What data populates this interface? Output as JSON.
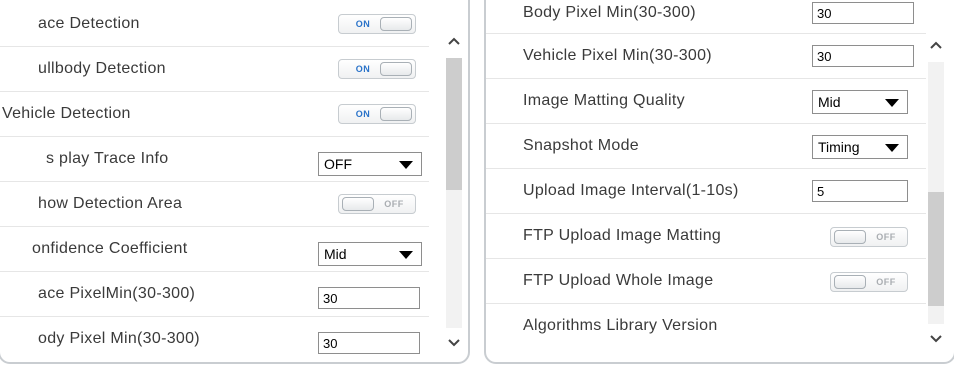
{
  "left_panel": {
    "rows": [
      {
        "label": "ace Detection",
        "control": "toggle",
        "state": "ON"
      },
      {
        "label": "ullbody Detection",
        "control": "toggle",
        "state": "ON"
      },
      {
        "label": "Vehicle Detection",
        "control": "toggle",
        "state": "ON"
      },
      {
        "label": "s play Trace Info",
        "control": "select",
        "value": "OFF"
      },
      {
        "label": "how Detection Area",
        "control": "toggle",
        "state": "OFF"
      },
      {
        "label": "onfidence Coefficient",
        "control": "select",
        "value": "Mid"
      },
      {
        "label": "ace PixelMin(30-300)",
        "control": "input",
        "value": "30"
      },
      {
        "label": "ody Pixel Min(30-300)",
        "control": "input",
        "value": "30"
      }
    ],
    "scroll_position": 0.2
  },
  "right_panel": {
    "rows": [
      {
        "label": "Body Pixel Min(30-300)",
        "control": "input",
        "value": "30"
      },
      {
        "label": "Vehicle Pixel Min(30-300)",
        "control": "input",
        "value": "30"
      },
      {
        "label": "Image Matting Quality",
        "control": "select",
        "value": "Mid"
      },
      {
        "label": "Snapshot Mode",
        "control": "select",
        "value": "Timing"
      },
      {
        "label": "Upload Image Interval(1-10s)",
        "control": "input",
        "value": "5"
      },
      {
        "label": "FTP Upload Image Matting",
        "control": "toggle",
        "state": "OFF"
      },
      {
        "label": "FTP Upload Whole Image",
        "control": "toggle",
        "state": "OFF"
      },
      {
        "label": "Algorithms Library Version",
        "control": "none"
      }
    ],
    "scroll_position": 0.85
  },
  "colors": {
    "panel_border": "#c9cdd1",
    "toggle_on_text": "#2a73c9",
    "toggle_off_text": "#a9adb1",
    "scroll_thumb": "#cdcdcd",
    "scroll_track": "#f2f2f2"
  },
  "icons": {
    "scroll_up": "chevron-up-icon",
    "scroll_down": "chevron-down-icon",
    "select_arrow": "triangle-down-icon"
  }
}
